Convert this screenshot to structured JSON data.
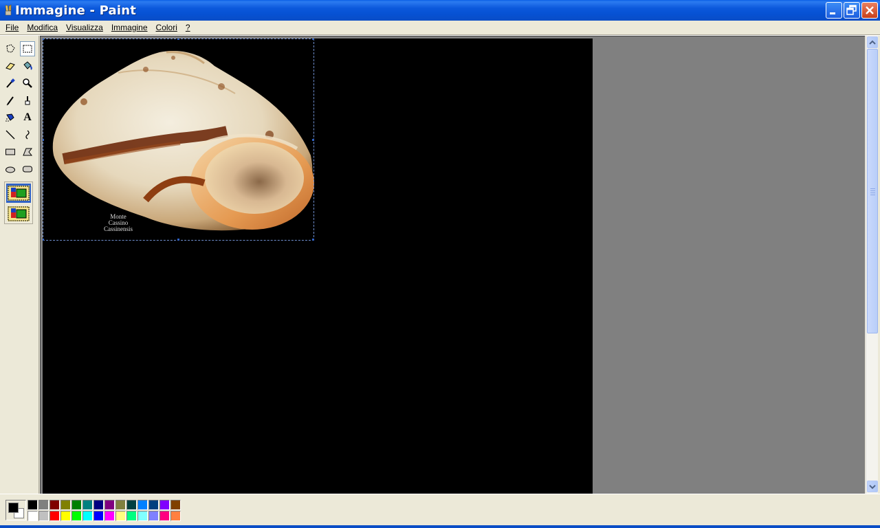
{
  "window": {
    "title": "Immagine - Paint",
    "title_bar_color": "#0A54D6",
    "controls": [
      "minimize-icon",
      "restore-icon",
      "close-icon"
    ]
  },
  "menu": {
    "items": [
      {
        "label": "File"
      },
      {
        "label": "Modifica"
      },
      {
        "label": "Visualizza"
      },
      {
        "label": "Immagine"
      },
      {
        "label": "Colori"
      },
      {
        "label": "?"
      }
    ]
  },
  "toolbox": {
    "tools": [
      {
        "name": "free-form-select",
        "icon": "free-form-select-icon"
      },
      {
        "name": "rectangle-select",
        "icon": "rectangle-select-icon",
        "selected": true
      },
      {
        "name": "eraser",
        "icon": "eraser-icon"
      },
      {
        "name": "fill-with-color",
        "icon": "paint-bucket-icon"
      },
      {
        "name": "pick-color",
        "icon": "eyedropper-icon"
      },
      {
        "name": "magnifier",
        "icon": "magnifier-icon"
      },
      {
        "name": "pencil",
        "icon": "pencil-icon"
      },
      {
        "name": "brush",
        "icon": "brush-icon"
      },
      {
        "name": "airbrush",
        "icon": "airbrush-icon"
      },
      {
        "name": "text",
        "icon": "text-icon",
        "glyph": "A"
      },
      {
        "name": "line",
        "icon": "line-icon"
      },
      {
        "name": "curve",
        "icon": "curve-icon"
      },
      {
        "name": "rectangle",
        "icon": "rectangle-icon"
      },
      {
        "name": "polygon",
        "icon": "polygon-icon"
      },
      {
        "name": "ellipse",
        "icon": "ellipse-icon"
      },
      {
        "name": "rounded-rectangle",
        "icon": "rounded-rectangle-icon"
      }
    ],
    "selection_options": [
      "opaque-selection",
      "transparent-selection"
    ]
  },
  "canvas": {
    "background": "#000000",
    "image_caption_line1": "Monte Cassino",
    "image_caption_line2": "Cassinensis"
  },
  "palette": {
    "foreground": "#000000",
    "background": "#FFFFFF",
    "row1": [
      "#000000",
      "#808080",
      "#800000",
      "#808000",
      "#008000",
      "#008080",
      "#000080",
      "#800080",
      "#808040",
      "#004040",
      "#0080FF",
      "#004080",
      "#8000FF",
      "#804000"
    ],
    "row2": [
      "#FFFFFF",
      "#C0C0C0",
      "#FF0000",
      "#FFFF00",
      "#00FF00",
      "#00FFFF",
      "#0000FF",
      "#FF00FF",
      "#FFFF80",
      "#00FF80",
      "#80FFFF",
      "#8080FF",
      "#FF0080",
      "#FF8040"
    ]
  }
}
